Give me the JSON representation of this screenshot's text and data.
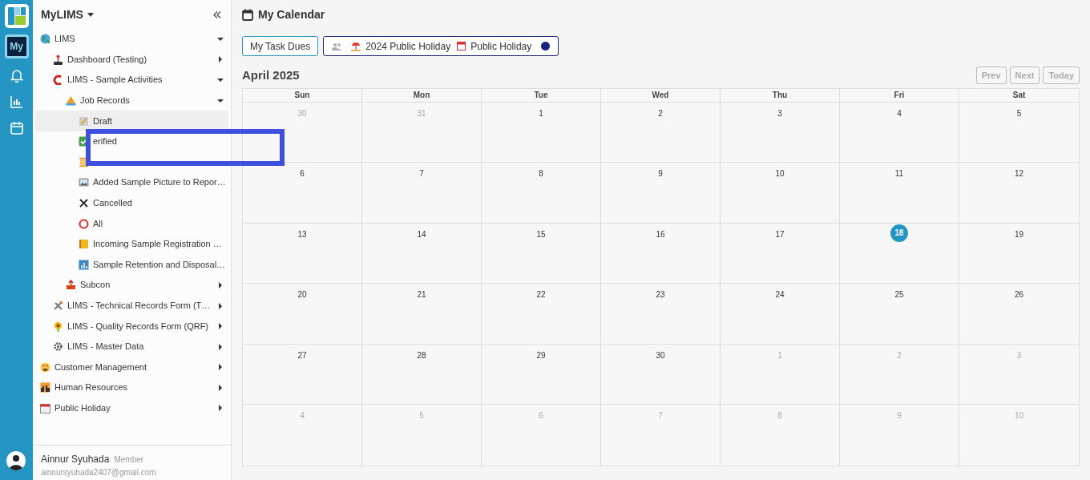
{
  "rail": {
    "items": [
      {
        "kind": "my",
        "label": "My",
        "selected": true
      },
      {
        "kind": "bell",
        "selected": false
      },
      {
        "kind": "chart",
        "selected": false
      },
      {
        "kind": "calendar",
        "selected": false
      }
    ]
  },
  "sidebar": {
    "title": "MyLIMS",
    "tree": [
      {
        "label": "LIMS",
        "expanded": true,
        "selected": false,
        "children": [
          {
            "label": "Dashboard (Testing)",
            "expanded": false,
            "selected": false
          },
          {
            "label": "LIMS - Sample Activities",
            "expanded": true,
            "selected": false,
            "children": [
              {
                "label": "Job Records",
                "expanded": true,
                "selected": false,
                "children": [
                  {
                    "label": "Draft",
                    "selected": true
                  },
                  {
                    "label": "erified",
                    "selected": false
                  },
                  {
                    "selected": false
                  },
                  {
                    "label": "Added Sample Picture to Repor…",
                    "selected": false
                  },
                  {
                    "label": "Cancelled",
                    "selected": false
                  },
                  {
                    "label": "All",
                    "selected": false
                  },
                  {
                    "label": "Incoming Sample Registration …",
                    "selected": false
                  },
                  {
                    "label": "Sample Retention and Disposal…",
                    "selected": false
                  }
                ]
              },
              {
                "label": "Subcon",
                "expanded": false,
                "selected": false
              }
            ]
          },
          {
            "label": "LIMS - Technical Records Form (T…",
            "expanded": false,
            "selected": false
          },
          {
            "label": "LIMS - Quality Records Form (QRF)",
            "expanded": false,
            "selected": false
          },
          {
            "label": "LIMS - Master Data",
            "expanded": false,
            "selected": false
          }
        ]
      },
      {
        "label": "Customer Management",
        "expanded": false,
        "selected": false
      },
      {
        "label": "Human Resources",
        "expanded": false,
        "selected": false
      },
      {
        "label": "Public Holiday",
        "expanded": false,
        "selected": false
      }
    ],
    "user": {
      "name": "Ainnur Syuhada",
      "role": "Member",
      "email": "ainnursyuhada2407@gmail.com"
    }
  },
  "main": {
    "title": "My Calendar",
    "task_button": "My Task Dues",
    "legend": [
      {
        "kind": "people"
      },
      {
        "kind": "beach",
        "label": "2024 Public Holiday"
      },
      {
        "kind": "calendar",
        "label": "Public Holiday"
      },
      {
        "kind": "dot",
        "color": "#1a237e"
      }
    ],
    "month": "April 2025",
    "nav_buttons": [
      "Prev",
      "Next",
      "Today"
    ],
    "weekdays": [
      "Sun",
      "Mon",
      "Tue",
      "Wed",
      "Thu",
      "Fri",
      "Sat"
    ],
    "weeks": [
      [
        {
          "day": "30",
          "in_month": false,
          "today": false
        },
        {
          "day": "31",
          "in_month": false,
          "today": false
        },
        {
          "day": "1",
          "in_month": true,
          "today": false
        },
        {
          "day": "2",
          "in_month": true,
          "today": false
        },
        {
          "day": "3",
          "in_month": true,
          "today": false
        },
        {
          "day": "4",
          "in_month": true,
          "today": false
        },
        {
          "day": "5",
          "in_month": true,
          "today": false
        }
      ],
      [
        {
          "day": "6",
          "in_month": true,
          "today": false
        },
        {
          "day": "7",
          "in_month": true,
          "today": false
        },
        {
          "day": "8",
          "in_month": true,
          "today": false
        },
        {
          "day": "9",
          "in_month": true,
          "today": false
        },
        {
          "day": "10",
          "in_month": true,
          "today": false
        },
        {
          "day": "11",
          "in_month": true,
          "today": false
        },
        {
          "day": "12",
          "in_month": true,
          "today": false
        }
      ],
      [
        {
          "day": "13",
          "in_month": true,
          "today": false
        },
        {
          "day": "14",
          "in_month": true,
          "today": false
        },
        {
          "day": "15",
          "in_month": true,
          "today": false
        },
        {
          "day": "16",
          "in_month": true,
          "today": false
        },
        {
          "day": "17",
          "in_month": true,
          "today": false
        },
        {
          "day": "18",
          "in_month": true,
          "today": true
        },
        {
          "day": "19",
          "in_month": true,
          "today": false
        }
      ],
      [
        {
          "day": "20",
          "in_month": true,
          "today": false
        },
        {
          "day": "21",
          "in_month": true,
          "today": false
        },
        {
          "day": "22",
          "in_month": true,
          "today": false
        },
        {
          "day": "23",
          "in_month": true,
          "today": false
        },
        {
          "day": "24",
          "in_month": true,
          "today": false
        },
        {
          "day": "25",
          "in_month": true,
          "today": false
        },
        {
          "day": "26",
          "in_month": true,
          "today": false
        }
      ],
      [
        {
          "day": "27",
          "in_month": true,
          "today": false
        },
        {
          "day": "28",
          "in_month": true,
          "today": false
        },
        {
          "day": "29",
          "in_month": true,
          "today": false
        },
        {
          "day": "30",
          "in_month": true,
          "today": false
        },
        {
          "day": "1",
          "in_month": false,
          "today": false
        },
        {
          "day": "2",
          "in_month": false,
          "today": false
        },
        {
          "day": "3",
          "in_month": false,
          "today": false
        }
      ],
      [
        {
          "day": "4",
          "in_month": false,
          "today": false
        },
        {
          "day": "5",
          "in_month": false,
          "today": false
        },
        {
          "day": "6",
          "in_month": false,
          "today": false
        },
        {
          "day": "7",
          "in_month": false,
          "today": false
        },
        {
          "day": "8",
          "in_month": false,
          "today": false
        },
        {
          "day": "9",
          "in_month": false,
          "today": false
        },
        {
          "day": "10",
          "in_month": false,
          "today": false
        }
      ]
    ]
  }
}
